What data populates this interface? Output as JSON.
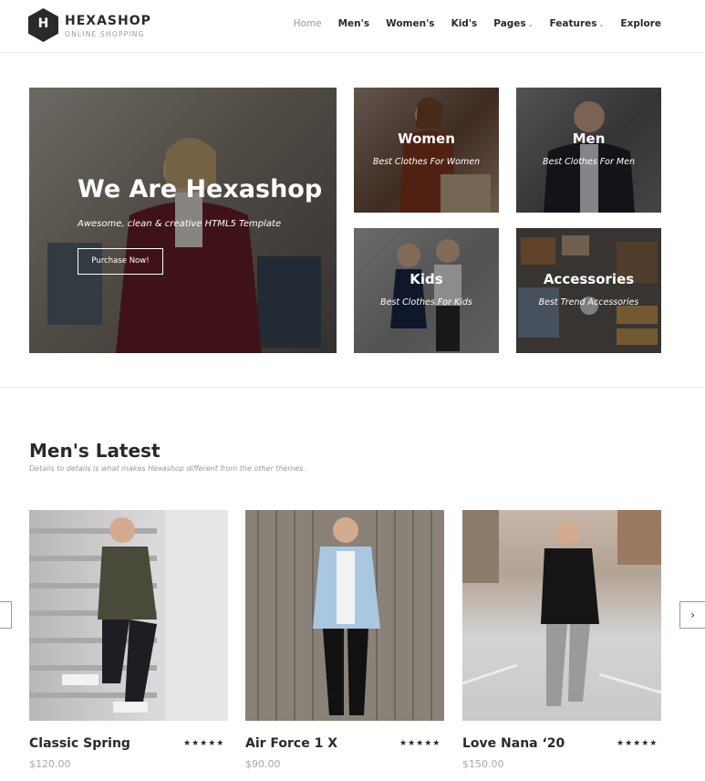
{
  "brand": {
    "name": "HEXASHOP",
    "tagline": "ONLINE SHOPPING",
    "letter": "H"
  },
  "nav": [
    {
      "label": "Home",
      "active": true,
      "dropdown": false
    },
    {
      "label": "Men's",
      "active": false,
      "dropdown": false
    },
    {
      "label": "Women's",
      "active": false,
      "dropdown": false
    },
    {
      "label": "Kid's",
      "active": false,
      "dropdown": false
    },
    {
      "label": "Pages",
      "active": false,
      "dropdown": true
    },
    {
      "label": "Features",
      "active": false,
      "dropdown": true
    },
    {
      "label": "Explore",
      "active": false,
      "dropdown": false
    }
  ],
  "hero": {
    "title": "We Are Hexashop",
    "subtitle": "Awesome, clean & creative HTML5 Template",
    "button": "Purchase Now!"
  },
  "categories": [
    {
      "title": "Women",
      "subtitle": "Best Clothes For Women"
    },
    {
      "title": "Men",
      "subtitle": "Best Clothes For Men"
    },
    {
      "title": "Kids",
      "subtitle": "Best Clothes For Kids"
    },
    {
      "title": "Accessories",
      "subtitle": "Best Trend Accessories"
    }
  ],
  "section": {
    "title": "Men's Latest",
    "subtitle": "Details to details is what makes Hexashop different from the other themes."
  },
  "products": [
    {
      "name": "Classic Spring",
      "price": "$120.00",
      "stars": "★★★★★",
      "rating": 5
    },
    {
      "name": "Air Force 1 X",
      "price": "$90.00",
      "stars": "★★★★★",
      "rating": 5
    },
    {
      "name": "Love Nana ‘20",
      "price": "$150.00",
      "stars": "★★★★★",
      "rating": 5
    }
  ],
  "carousel": {
    "prev_icon": "‹",
    "next_icon": "›"
  },
  "colors": {
    "text": "#2a2a2a",
    "muted": "#999999",
    "overlay": "rgba(0,0,0,0.42)"
  }
}
